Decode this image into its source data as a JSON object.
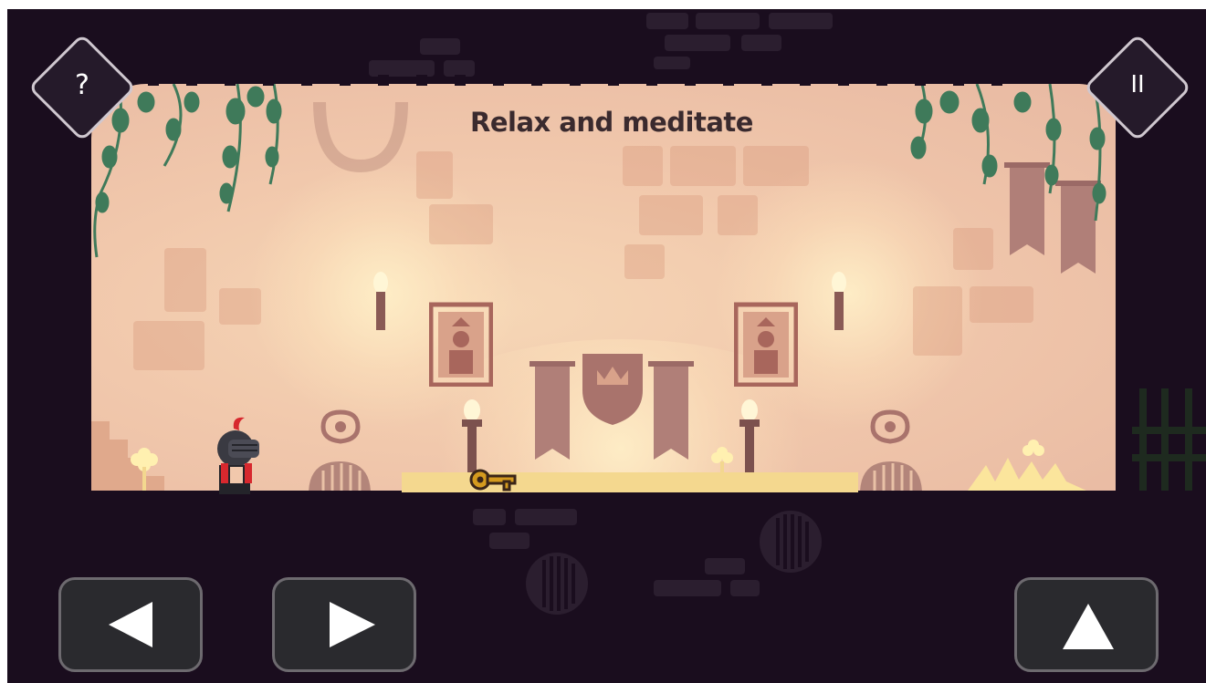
{
  "level": {
    "message": "Relax and meditate"
  },
  "hud": {
    "help_label": "?",
    "pause_label": "II"
  },
  "controls": {
    "left_icon": "arrow-left-icon",
    "right_icon": "arrow-right-icon",
    "jump_icon": "arrow-up-icon"
  },
  "colors": {
    "background": "#1a0d1e",
    "room_wall": "#f1c8ac",
    "key": "#d49a1e",
    "knight_plume": "#d7282e",
    "vine": "#3f7a5a"
  }
}
